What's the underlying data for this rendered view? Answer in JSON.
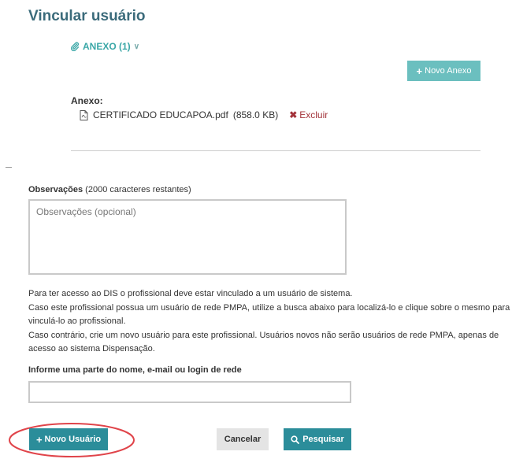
{
  "header": {
    "title": "Vincular usuário"
  },
  "anexo": {
    "toggle_label": "ANEXO (1)",
    "new_button_label": "Novo Anexo",
    "label": "Anexo:",
    "file_name": "CERTIFICADO EDUCAPOA.pdf",
    "file_size": "(858.0 KB)",
    "delete_label": "Excluir"
  },
  "observacoes": {
    "label": "Observações",
    "counter": "(2000 caracteres restantes)",
    "placeholder": "Observações (opcional)"
  },
  "info": {
    "line1": "Para ter acesso ao DIS o profissional deve estar vinculado a um usuário de sistema.",
    "line2": "Caso este profissional possua um usuário de rede PMPA, utilize a busca abaixo para localizá-lo e clique sobre o mesmo para",
    "line3": "vinculá-lo ao profissional.",
    "line4": "Caso contrário, crie um novo usuário para este profissional. Usuários novos não serão usuários de rede PMPA, apenas de",
    "line5": "acesso ao sistema Dispensação."
  },
  "search": {
    "label": "Informe uma parte do nome, e-mail ou login de rede",
    "value": ""
  },
  "actions": {
    "new_user_label": "Novo Usuário",
    "cancel_label": "Cancelar",
    "search_label": "Pesquisar"
  },
  "colors": {
    "title": "#3b6b7b",
    "accent": "#3aa7a7",
    "primary_button": "#2b8d9a",
    "secondary_button": "#6bbfbf",
    "danger": "#a3333a",
    "highlight": "#e0444a"
  },
  "icons": {
    "paperclip": "paperclip-icon",
    "chevron": "chevron-double-down-icon",
    "plus": "plus-icon",
    "pdf": "pdf-file-icon",
    "delete": "close-icon",
    "search": "search-icon"
  }
}
